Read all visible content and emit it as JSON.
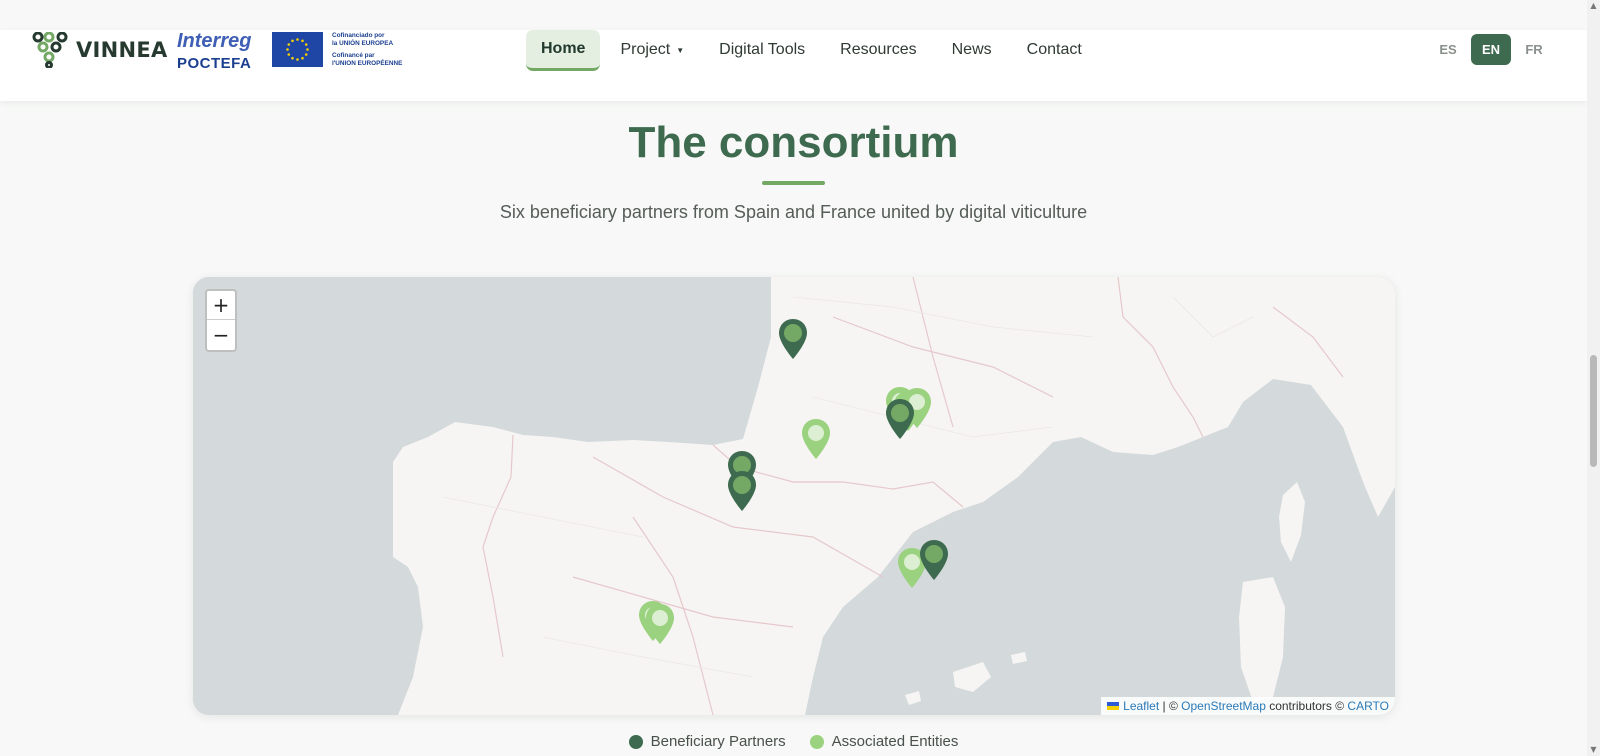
{
  "brand": {
    "logo_text": "VINNEA"
  },
  "interreg": {
    "line1": "Interreg",
    "line2": "POCTEFA"
  },
  "eu_cofunding": {
    "es_line1": "Cofinanciado por",
    "es_line2": "la UNIÓN EUROPEA",
    "fr_line1": "Cofinancé par",
    "fr_line2": "l'UNION EUROPÉENNE"
  },
  "nav": {
    "home": "Home",
    "project": "Project",
    "digital_tools": "Digital Tools",
    "resources": "Resources",
    "news": "News",
    "contact": "Contact"
  },
  "languages": {
    "es": "ES",
    "en": "EN",
    "fr": "FR",
    "active": "EN"
  },
  "section": {
    "title": "The consortium",
    "subtitle": "Six beneficiary partners from Spain and France united by digital viticulture"
  },
  "map": {
    "zoom_in": "+",
    "zoom_out": "−",
    "attribution": {
      "leaflet": "Leaflet",
      "sep": " | © ",
      "osm": "OpenStreetMap",
      "contributors": " contributors © ",
      "carto": "CARTO"
    },
    "colors": {
      "beneficiary": "#3e6b4f",
      "beneficiary_inner": "#74a865",
      "associated": "#9bd27f",
      "associated_inner": "#dcefd2",
      "sea": "#d4d9dc",
      "land": "#f6f5f3"
    }
  },
  "legend": {
    "beneficiary": "Beneficiary Partners",
    "associated": "Associated Entities",
    "beneficiary_color": "#3e6b4f",
    "associated_color": "#9bd27f"
  }
}
